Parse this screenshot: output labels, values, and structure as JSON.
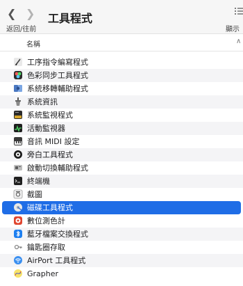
{
  "toolbar": {
    "title": "工具程式",
    "nav_label": "返回/往前",
    "view_label": "顯示"
  },
  "list_header": {
    "name_col": "名稱"
  },
  "items": [
    {
      "label": "工序指令編寫程式",
      "icon": "script-editor-icon"
    },
    {
      "label": "色彩同步工具程式",
      "icon": "colorsync-icon"
    },
    {
      "label": "系統移轉輔助程式",
      "icon": "migration-assistant-icon"
    },
    {
      "label": "系統資訊",
      "icon": "system-information-icon"
    },
    {
      "label": "系統監視程式",
      "icon": "console-icon"
    },
    {
      "label": "活動監視器",
      "icon": "activity-monitor-icon"
    },
    {
      "label": "音訊 MIDI 設定",
      "icon": "audio-midi-setup-icon"
    },
    {
      "label": "旁白工具程式",
      "icon": "voiceover-utility-icon"
    },
    {
      "label": "啟動切換輔助程式",
      "icon": "boot-camp-assistant-icon"
    },
    {
      "label": "終端機",
      "icon": "terminal-icon"
    },
    {
      "label": "截圖",
      "icon": "screenshot-icon"
    },
    {
      "label": "磁碟工具程式",
      "icon": "disk-utility-icon",
      "selected": true
    },
    {
      "label": "數位測色計",
      "icon": "digital-color-meter-icon"
    },
    {
      "label": "藍牙檔案交換程式",
      "icon": "bluetooth-file-exchange-icon"
    },
    {
      "label": "鑰匙圈存取",
      "icon": "keychain-access-icon"
    },
    {
      "label": "AirPort 工具程式",
      "icon": "airport-utility-icon"
    },
    {
      "label": "Grapher",
      "icon": "grapher-icon"
    }
  ],
  "colors": {
    "selection": "#1f6de6",
    "toolbar_bg": "#f6f6f6"
  }
}
